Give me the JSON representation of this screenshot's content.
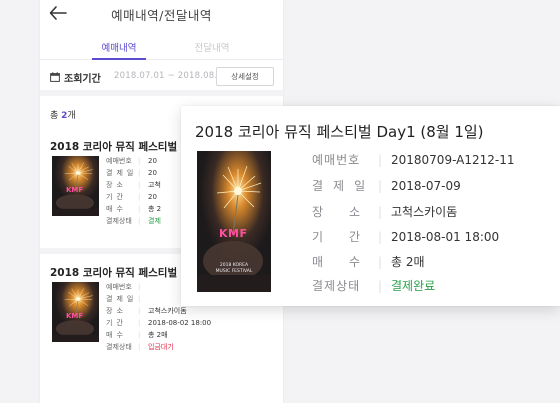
{
  "header": {
    "title": "예매내역/전달내역",
    "back_icon": "arrow-left-icon"
  },
  "tabs": [
    {
      "label": "예매내역",
      "active": true
    },
    {
      "label": "전달내역",
      "active": false
    }
  ],
  "period": {
    "icon": "calendar-icon",
    "label": "조회기간",
    "value": "2018.07.01 ~ 2018.08.01",
    "detail_button": "상세설정"
  },
  "total": {
    "prefix": "총 ",
    "count": "2",
    "suffix": "개"
  },
  "bookings": [
    {
      "title": "2018 코리아 뮤직 페스티벌 Day",
      "rows": [
        {
          "label": "예매번호",
          "value": "20",
          "compact": true
        },
        {
          "label": "결제일",
          "value": "20",
          "compact": false
        },
        {
          "label": "장소",
          "value": "고척",
          "compact": false
        },
        {
          "label": "기간",
          "value": "20",
          "compact": false
        },
        {
          "label": "매수",
          "value": "총 2",
          "compact": false
        },
        {
          "label": "결제상태",
          "value": "결제",
          "compact": true,
          "status": "done"
        }
      ]
    },
    {
      "title": "2018 코리아 뮤직 페스티벌 Day",
      "rows": [
        {
          "label": "예매번호",
          "value": "",
          "compact": true
        },
        {
          "label": "결제일",
          "value": "",
          "compact": false
        },
        {
          "label": "장소",
          "value": "고척스카이돔",
          "compact": false
        },
        {
          "label": "기간",
          "value": "2018-08-02 18:00",
          "compact": false
        },
        {
          "label": "매수",
          "value": "총 2매",
          "compact": false
        },
        {
          "label": "결제상태",
          "value": "입금대기",
          "compact": true,
          "status": "pending"
        }
      ]
    }
  ],
  "popup": {
    "title": "2018 코리아 뮤직 페스티벌 Day1 (8월 1일)",
    "rows": [
      {
        "label": "예매번호",
        "value": "20180709-A1212-11",
        "compact": true
      },
      {
        "label": "결제일",
        "value": "2018-07-09",
        "compact": false
      },
      {
        "label": "장소",
        "value": "고척스카이돔",
        "compact": false
      },
      {
        "label": "기간",
        "value": "2018-08-01 18:00",
        "compact": false
      },
      {
        "label": "매수",
        "value": "총 2매",
        "compact": false
      },
      {
        "label": "결제상태",
        "value": "결제완료",
        "compact": true,
        "status": "done"
      }
    ]
  },
  "poster": {
    "logo": "KMF",
    "lines": [
      "2018 KOREA",
      "MUSIC FESTIVAL"
    ]
  },
  "colors": {
    "accent": "#5a4bd1",
    "status_done": "#2aa04a",
    "status_pending": "#e0304c"
  }
}
